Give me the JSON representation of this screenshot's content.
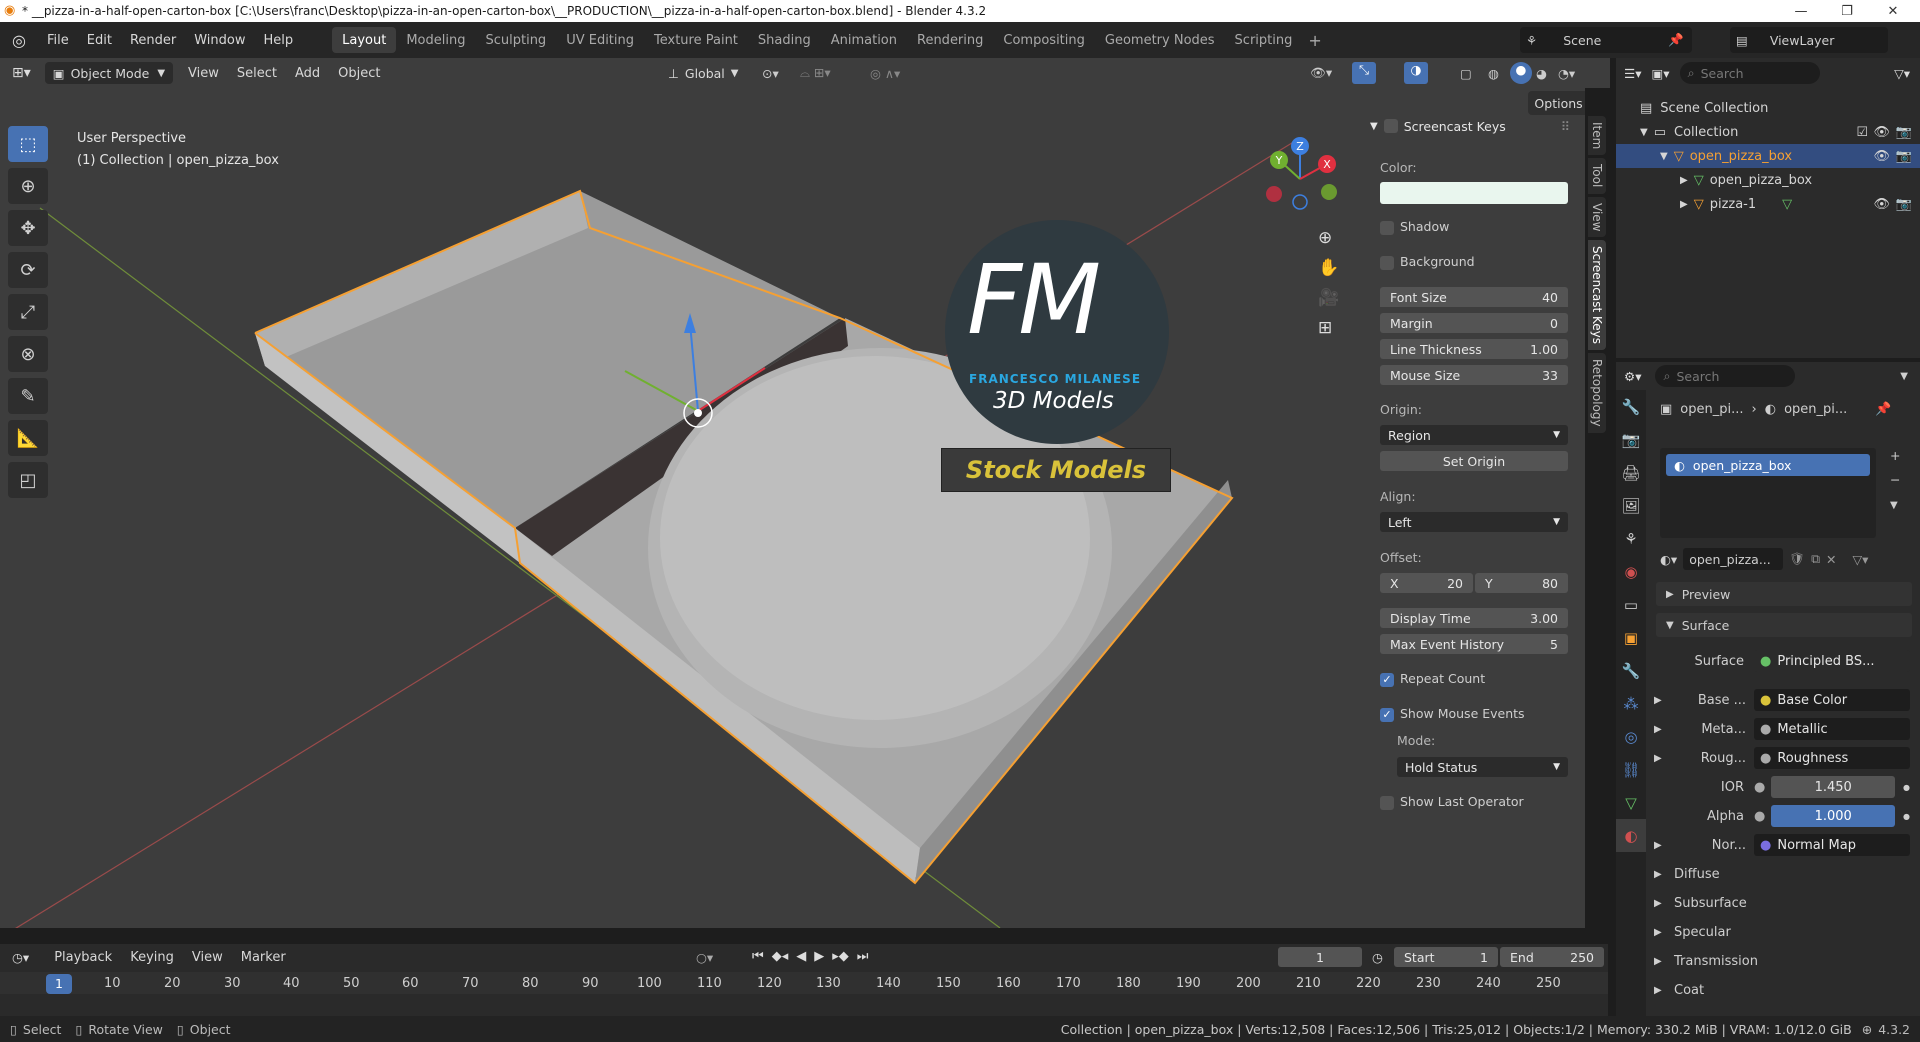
{
  "window": {
    "title": "* __pizza-in-a-half-open-carton-box [C:\\Users\\franc\\Desktop\\pizza-in-an-open-carton-box\\__PRODUCTION\\__pizza-in-a-half-open-carton-box.blend] - Blender 4.3.2"
  },
  "menu": [
    "File",
    "Edit",
    "Render",
    "Window",
    "Help"
  ],
  "workspaces": [
    "Layout",
    "Modeling",
    "Sculpting",
    "UV Editing",
    "Texture Paint",
    "Shading",
    "Animation",
    "Rendering",
    "Compositing",
    "Geometry Nodes",
    "Scripting"
  ],
  "active_workspace": "Layout",
  "scene": {
    "label": "Scene",
    "view_layer": "ViewLayer"
  },
  "viewport_header": {
    "mode": "Object Mode",
    "menus": [
      "View",
      "Select",
      "Add",
      "Object"
    ],
    "orientation": "Global",
    "options": "Options"
  },
  "viewport": {
    "perspective": "User Perspective",
    "collection_info": "(1) Collection | open_pizza_box",
    "axis_labels": {
      "x": "X",
      "y": "Y",
      "z": "Z"
    }
  },
  "logo": {
    "letters": "FM",
    "name": "FRANCESCO MILANESE",
    "subtitle": "3D Models",
    "banner": "Stock Models"
  },
  "screencast": {
    "header": "Screencast Keys",
    "color_label": "Color:",
    "shadow": "Shadow",
    "background": "Background",
    "fields": [
      {
        "label": "Font Size",
        "value": "40"
      },
      {
        "label": "Margin",
        "value": "0"
      },
      {
        "label": "Line Thickness",
        "value": "1.00"
      },
      {
        "label": "Mouse Size",
        "value": "33"
      }
    ],
    "origin_label": "Origin:",
    "origin_value": "Region",
    "set_origin": "Set Origin",
    "align_label": "Align:",
    "align_value": "Left",
    "offset_label": "Offset:",
    "offset_x_label": "X",
    "offset_x": "20",
    "offset_y_label": "Y",
    "offset_y": "80",
    "display_time_label": "Display Time",
    "display_time": "3.00",
    "max_history_label": "Max Event History",
    "max_history": "5",
    "repeat_count": "Repeat Count",
    "show_mouse_events": "Show Mouse Events",
    "mode_label": "Mode:",
    "mode_value": "Hold Status",
    "show_last_operator": "Show Last Operator"
  },
  "side_tabs": [
    "Item",
    "Tool",
    "View",
    "Screencast Keys",
    "Retopology"
  ],
  "outliner": {
    "search_placeholder": "Search",
    "scene_collection": "Scene Collection",
    "collection": "Collection",
    "items": [
      "open_pizza_box",
      "open_pizza_box",
      "pizza-1"
    ]
  },
  "properties": {
    "search_placeholder": "Search",
    "breadcrumb_1": "open_pi...",
    "breadcrumb_2": "open_pi...",
    "slot": "open_pizza_box",
    "material_name": "open_pizza...",
    "sections": {
      "preview": "Preview",
      "surface": "Surface"
    },
    "surface_label": "Surface",
    "surface_value": "Principled BS...",
    "rows": [
      {
        "label": "Base ...",
        "value": "Base Color"
      },
      {
        "label": "Meta...",
        "value": "Metallic"
      },
      {
        "label": "Roug...",
        "value": "Roughness"
      }
    ],
    "ior_label": "IOR",
    "ior_value": "1.450",
    "alpha_label": "Alpha",
    "alpha_value": "1.000",
    "normal_label": "Nor...",
    "normal_value": "Normal Map",
    "collapsed": [
      "Diffuse",
      "Subsurface",
      "Specular",
      "Transmission",
      "Coat"
    ]
  },
  "timeline": {
    "menus": [
      "Playback",
      "Keying",
      "View",
      "Marker"
    ],
    "current_frame": "1",
    "start_label": "Start",
    "start": "1",
    "end_label": "End",
    "end": "250",
    "ticks": [
      "1",
      "10",
      "20",
      "30",
      "40",
      "50",
      "60",
      "70",
      "80",
      "90",
      "100",
      "110",
      "120",
      "130",
      "140",
      "150",
      "160",
      "170",
      "180",
      "190",
      "200",
      "210",
      "220",
      "230",
      "240",
      "250"
    ]
  },
  "status": {
    "hints": [
      "Select",
      "Rotate View",
      "Object"
    ],
    "info": "Collection | open_pizza_box | Verts:12,508 | Faces:12,506 | Tris:25,012 | Objects:1/2 | Memory: 330.2 MiB | VRAM: 1.0/12.0 GiB",
    "version": "4.3.2"
  },
  "colors": {
    "accent": "#4772b3",
    "selection": "#f5a033",
    "panel": "#2b2b2b",
    "viewport": "#3d3d3d"
  }
}
